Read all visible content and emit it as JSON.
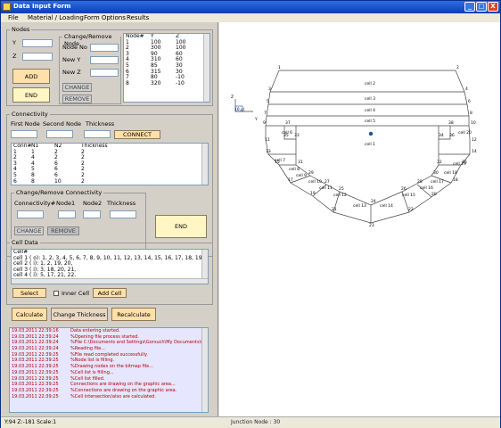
{
  "window": {
    "title": "Data Input Form",
    "buttons": [
      "_",
      "□",
      "X"
    ]
  },
  "menu": [
    "File",
    "Material / Loading",
    "Form Options",
    "Results"
  ],
  "nodes": {
    "caption": "Nodes",
    "y_label": "Y",
    "z_label": "Z",
    "add": "ADD",
    "end": "END",
    "change_group": "Change/Remove Node",
    "node_no": "Node No",
    "new_y": "New Y",
    "new_z": "New Z",
    "change": "CHANGE",
    "remove": "REMOVE",
    "list_headers": [
      "Node#",
      "Y",
      "Z"
    ],
    "list_rows": [
      [
        "1",
        "100",
        "100"
      ],
      [
        "2",
        "300",
        "100"
      ],
      [
        "3",
        "90",
        "60"
      ],
      [
        "4",
        "310",
        "60"
      ],
      [
        "5",
        "85",
        "30"
      ],
      [
        "6",
        "315",
        "30"
      ],
      [
        "7",
        "80",
        "-10"
      ],
      [
        "8",
        "320",
        "-10"
      ]
    ]
  },
  "connectivity": {
    "caption": "Connectivity",
    "first_node": "First Node",
    "second_node": "Second Node",
    "thickness": "Thickness",
    "connect": "CONNECT",
    "list_headers": [
      "Conn#",
      "N1",
      "N2",
      "Thickness"
    ],
    "list_rows": [
      [
        "1",
        "1",
        "2",
        "2"
      ],
      [
        "2",
        "4",
        "2",
        "2"
      ],
      [
        "3",
        "4",
        "6",
        "2"
      ],
      [
        "4",
        "5",
        "6",
        "2"
      ],
      [
        "5",
        "8",
        "6",
        "2"
      ],
      [
        "6",
        "8",
        "10",
        "2"
      ]
    ],
    "change_group": "Change/Remove Connectivity",
    "conn_no": "Connectivity#",
    "node1": "Node1",
    "node2": "Node2",
    "thick": "Thickness",
    "change": "CHANGE",
    "remove": "REMOVE",
    "end": "END"
  },
  "cell": {
    "caption": "Cell Data",
    "header": "Cell#",
    "lines": [
      "cell 1 ( o): 1, 2, 3, 4, 5, 6, 7, 8, 9, 10, 11, 12, 13, 14, 15, 16, 17, 18, 19,",
      "cell 2 ( i): 1, 2, 19, 20,",
      "cell 3 ( i): 3, 18, 20, 21,",
      "cell 4 ( i): 5, 17, 21, 22,"
    ],
    "select": "Select",
    "inner_cell": "Inner Cell",
    "add_cell": "Add Cell"
  },
  "actions": {
    "calculate": "Calculate",
    "change_thickness": "Change Thickness",
    "recalculate": "Recalculate"
  },
  "log": [
    [
      "19.03.2011 22:39:16",
      "Data entering started."
    ],
    [
      "19.03.2011 22:39:24",
      "%Opening file process started."
    ],
    [
      "19.03.2011 22:39:24",
      "%File C:\\Documents and Settings\\Gorsuch\\My Documents\\Gorsu"
    ],
    [
      "19.03.2011 22:39:24",
      "%Reading file..."
    ],
    [
      "19.03.2011 22:39:25",
      "%File read completed successfully."
    ],
    [
      "19.03.2011 22:39:25",
      "%Node list is filling."
    ],
    [
      "19.03.2011 22:39:25",
      "%Drawing nodes on the bitmap file..."
    ],
    [
      "19.03.2011 22:39:25",
      "%Cell list is filling..."
    ],
    [
      "19.03.2011 22:39:25",
      "%Cell list filled."
    ],
    [
      "19.03.2011 22:39:25",
      "Connections are drawing on the graphic area..."
    ],
    [
      "19.03.2011 22:39:25",
      "%Connections are drawing on the graphic area."
    ],
    [
      "19.03.2011 22:39:25",
      "%Cell intersection/also are calculated."
    ]
  ],
  "status": {
    "coords": "Y:94  Z:-181  Scale:1",
    "junction": "Junction Node : 30"
  },
  "drawing": {
    "axis_z": "Z",
    "axis_y": "Y",
    "origin_label": "(0,y)",
    "cells": [
      "cell 2",
      "cell 3",
      "cell 4",
      "cell 5",
      "cell 6",
      "cell 1",
      "cell 7",
      "cell 8",
      "cell 9",
      "cell 10",
      "cell 11",
      "cell 12",
      "cell 13",
      "cell 14",
      "cell 15",
      "cell 16",
      "cell 17",
      "cell 18",
      "cell 19",
      "cell 20"
    ],
    "node_labels": [
      "1",
      "2",
      "3",
      "4",
      "5",
      "6",
      "7",
      "8",
      "9",
      "10",
      "11",
      "12",
      "13",
      "14",
      "15",
      "16",
      "17",
      "18",
      "19",
      "20",
      "21",
      "22",
      "23",
      "24",
      "25",
      "26",
      "27",
      "28",
      "29",
      "30",
      "31",
      "32",
      "33",
      "34",
      "35",
      "36",
      "37",
      "38"
    ]
  }
}
